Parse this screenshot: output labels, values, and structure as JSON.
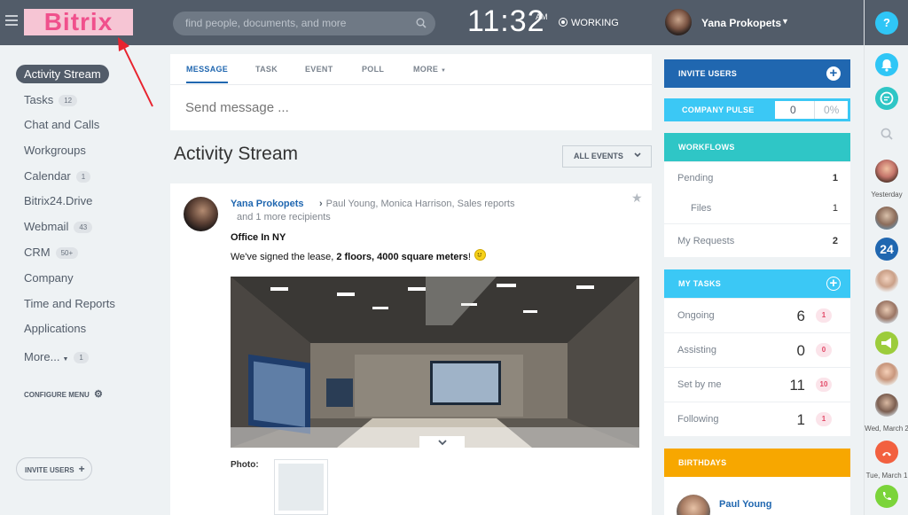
{
  "header": {
    "logo": "Bitrix",
    "search_placeholder": "find people, documents, and more",
    "clock": "11:32",
    "ampm": "AM",
    "status": "WORKING",
    "user_name": "Yana Prokopets"
  },
  "sidebar": {
    "items": [
      {
        "label": "Activity Stream",
        "count": ""
      },
      {
        "label": "Tasks",
        "count": "12"
      },
      {
        "label": "Chat and Calls",
        "count": ""
      },
      {
        "label": "Workgroups",
        "count": ""
      },
      {
        "label": "Calendar",
        "count": "1"
      },
      {
        "label": "Bitrix24.Drive",
        "count": ""
      },
      {
        "label": "Webmail",
        "count": "43"
      },
      {
        "label": "CRM",
        "count": "50+"
      },
      {
        "label": "Company",
        "count": ""
      },
      {
        "label": "Time and Reports",
        "count": ""
      },
      {
        "label": "Applications",
        "count": ""
      },
      {
        "label": "More...",
        "count": "1"
      }
    ],
    "configure_menu": "CONFIGURE MENU",
    "invite_users": "INVITE USERS"
  },
  "composer": {
    "tabs": [
      "MESSAGE",
      "TASK",
      "EVENT",
      "POLL",
      "MORE"
    ],
    "placeholder": "Send message ..."
  },
  "feed": {
    "title": "Activity Stream",
    "filter": "ALL EVENTS"
  },
  "post": {
    "author": "Yana Prokopets",
    "recipients": "Paul Young, Monica Harrison, Sales reports",
    "more_recipients": "and 1 more recipients",
    "title": "Office In NY",
    "text_prefix": "We've signed the lease, ",
    "text_bold": "2 floors, 4000 square meters",
    "text_suffix": "!",
    "photo_label": "Photo:"
  },
  "widgets": {
    "invite_users": "INVITE USERS",
    "company_pulse": {
      "label": "COMPANY PULSE",
      "value": "0",
      "percent": "0%"
    },
    "workflows": {
      "title": "WORKFLOWS",
      "rows": [
        {
          "label": "Pending",
          "value": "1"
        },
        {
          "label": "Files",
          "value": "1"
        },
        {
          "label": "My Requests",
          "value": "2"
        }
      ]
    },
    "my_tasks": {
      "title": "MY TASKS",
      "rows": [
        {
          "label": "Ongoing",
          "value": "6",
          "badge": "1"
        },
        {
          "label": "Assisting",
          "value": "0",
          "badge": "0"
        },
        {
          "label": "Set by me",
          "value": "11",
          "badge": "10"
        },
        {
          "label": "Following",
          "value": "1",
          "badge": "1"
        }
      ]
    },
    "birthdays": {
      "title": "BIRTHDAYS",
      "person": "Paul Young"
    }
  },
  "rightbar": {
    "help": "?",
    "label_yesterday": "Yesterday",
    "counter": "24",
    "label_wed": "Wed, March 2",
    "label_tue": "Tue, March 1"
  },
  "colors": {
    "topbar": "#525c69",
    "invite": "#2067b0",
    "pulse": "#3bc8f5",
    "workflows": "#2fc6c6",
    "tasks": "#3bc8f5",
    "birthdays": "#f7a700",
    "logo_bg": "#f6c5d4",
    "logo_text": "#f0508c",
    "annotation_arrow": "#e8232e"
  }
}
